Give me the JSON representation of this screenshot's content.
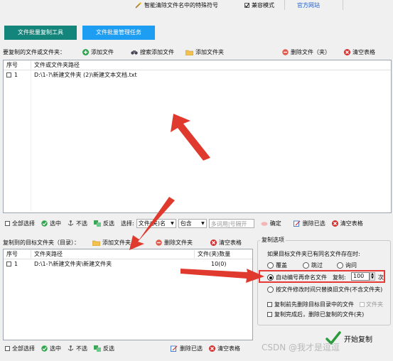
{
  "topbar": {
    "special_chars": "智能清除文件名中的特殊符号",
    "compat_mode": "兼容模式",
    "official_site": "官方网站"
  },
  "tabs": [
    "文件批量复制工具",
    "文件批量管理任务"
  ],
  "source": {
    "label": "要复制的文件或文件夹：",
    "add_file": "添加文件",
    "search_add_file": "搜索添加文件",
    "add_folder": "添加文件夹",
    "delete_file": "删除文件（夹）",
    "clear_table": "清空表格",
    "col_index": "序号",
    "col_path": "文件或文件夹路径",
    "rows": [
      {
        "index": "1",
        "path": "D:\\1-?\\新建文件夹 (2)\\新建文本文档.txt"
      }
    ]
  },
  "source_toolbar": {
    "select_all": "全部选择",
    "select": "选中",
    "deselect": "不选",
    "invert": "反选",
    "choose_label": "选择:",
    "type_select": "文件(夹)名",
    "match_select": "包含",
    "match_placeholder": "多词用|号隔开",
    "confirm": "确定",
    "delete_selected": "删除已选",
    "clear_table": "清空表格"
  },
  "target": {
    "label": "复制到的目标文件夹（目录）：",
    "add_folder": "添加文件夹",
    "delete_folder": "删除文件夹",
    "clear_table": "清空表格",
    "col_index": "序号",
    "col_path": "文件夹路径",
    "col_count": "文件(夹)数量",
    "rows": [
      {
        "index": "1",
        "path": "D:\\1-?\\新建文件夹\\新建文件夹",
        "count": "10(0)"
      }
    ]
  },
  "target_toolbar": {
    "select_all": "全部选择",
    "select": "选中",
    "deselect": "不选",
    "invert": "反选",
    "delete_selected": "删除已选",
    "clear_table": "清空表格"
  },
  "options": {
    "title": "复制选项",
    "question": "如果目标文件夹已有同名文件存在时:",
    "overwrite": "覆盖",
    "skip": "跳过",
    "ask": "询问",
    "auto_rename": "自动编号再命名文件",
    "copies_label": "复制:",
    "copies_value": "100",
    "copies_unit": "次",
    "by_date": "按文件修改时间只替换旧文件(不含文件夹)",
    "clear_before": "复制前先删除目标目录中的文件",
    "folder_label": "文件夹",
    "delete_after": "复制完成后，删除已复制的文件(夹)"
  },
  "start_button": "开始复制",
  "watermark": "CSDN @我才是逗逗",
  "colors": {
    "tab_active": "#1e9ef3",
    "tab_inactive": "#14857a",
    "arrow": "#e03a2e",
    "highlight": "#e53935"
  }
}
